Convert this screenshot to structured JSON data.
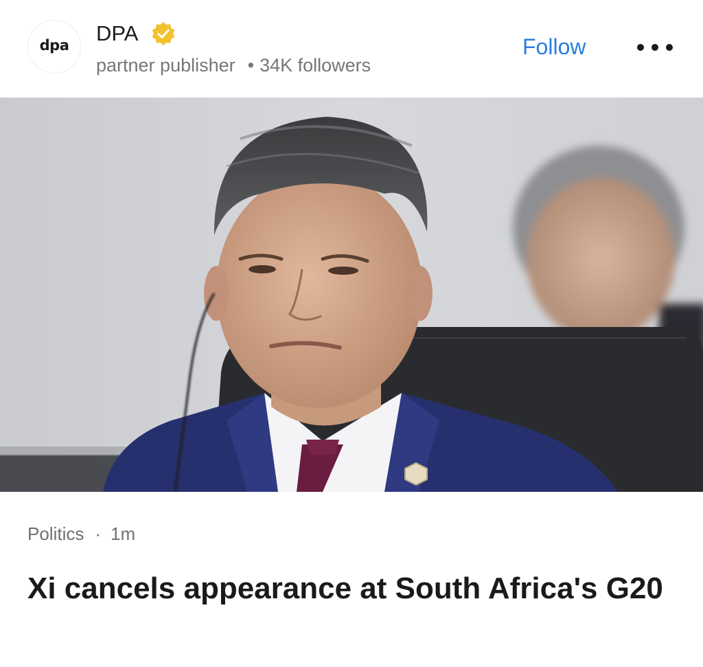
{
  "publisher": {
    "logo_text": "dpa",
    "name": "DPA",
    "verified_icon": "verified-badge-icon",
    "badge_color": "#f2c12e",
    "type": "partner publisher",
    "separator": "•",
    "followers": "34K followers",
    "follow_label": "Follow",
    "follow_color": "#2a7de1",
    "more_icon": "more-options-icon"
  },
  "article": {
    "category": "Politics",
    "separator": "·",
    "time": "1m",
    "headline": "Xi cancels appearance at South Africa's G20"
  }
}
